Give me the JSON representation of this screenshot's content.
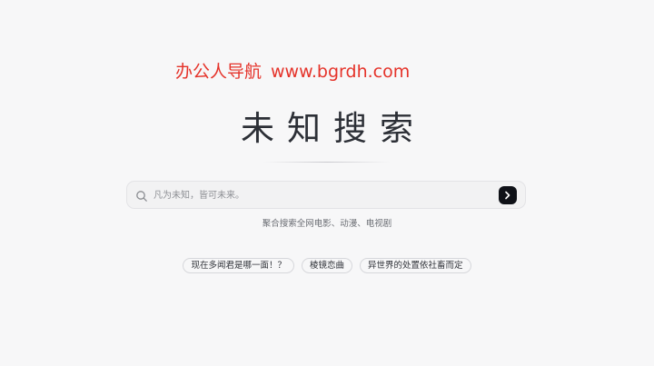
{
  "watermark": {
    "brand": "办公人导航",
    "url": "www.bgrdh.com"
  },
  "hero": {
    "title": "未知搜索"
  },
  "search": {
    "placeholder": "凡为未知，皆可未来。",
    "value": ""
  },
  "subtitle": "聚合搜索全网电影、动漫、电视剧",
  "suggestions": [
    {
      "label": "现在多闻君是哪一面！？"
    },
    {
      "label": "棱镜恋曲"
    },
    {
      "label": "异世界的处置依社畜而定"
    }
  ],
  "icons": {
    "search": "search-icon",
    "submit": "chevron-right-icon"
  },
  "colors": {
    "background": "#f7f7f8",
    "watermark": "#e5332a",
    "submit_button": "#0f1117"
  }
}
